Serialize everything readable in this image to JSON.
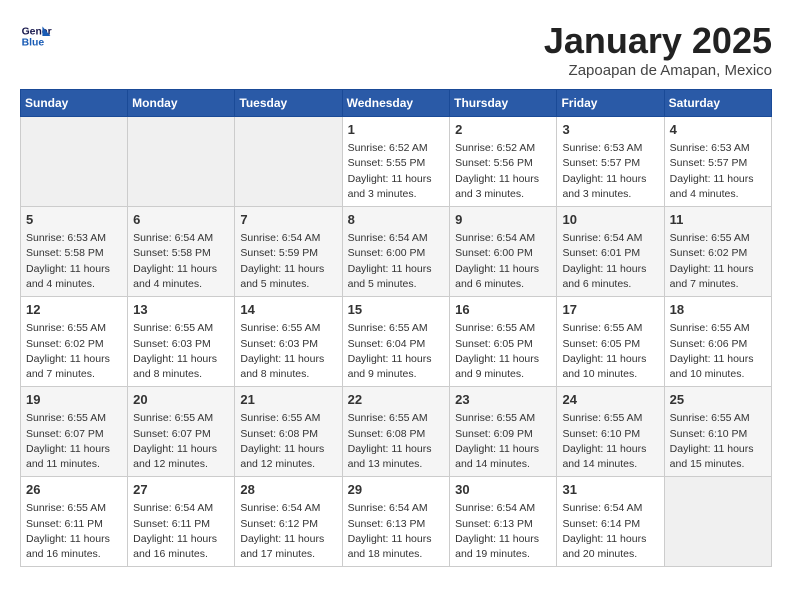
{
  "logo": {
    "line1": "General",
    "line2": "Blue"
  },
  "title": "January 2025",
  "location": "Zapoapan de Amapan, Mexico",
  "headers": [
    "Sunday",
    "Monday",
    "Tuesday",
    "Wednesday",
    "Thursday",
    "Friday",
    "Saturday"
  ],
  "weeks": [
    [
      {
        "day": "",
        "info": ""
      },
      {
        "day": "",
        "info": ""
      },
      {
        "day": "",
        "info": ""
      },
      {
        "day": "1",
        "info": "Sunrise: 6:52 AM\nSunset: 5:55 PM\nDaylight: 11 hours and 3 minutes."
      },
      {
        "day": "2",
        "info": "Sunrise: 6:52 AM\nSunset: 5:56 PM\nDaylight: 11 hours and 3 minutes."
      },
      {
        "day": "3",
        "info": "Sunrise: 6:53 AM\nSunset: 5:57 PM\nDaylight: 11 hours and 3 minutes."
      },
      {
        "day": "4",
        "info": "Sunrise: 6:53 AM\nSunset: 5:57 PM\nDaylight: 11 hours and 4 minutes."
      }
    ],
    [
      {
        "day": "5",
        "info": "Sunrise: 6:53 AM\nSunset: 5:58 PM\nDaylight: 11 hours and 4 minutes."
      },
      {
        "day": "6",
        "info": "Sunrise: 6:54 AM\nSunset: 5:58 PM\nDaylight: 11 hours and 4 minutes."
      },
      {
        "day": "7",
        "info": "Sunrise: 6:54 AM\nSunset: 5:59 PM\nDaylight: 11 hours and 5 minutes."
      },
      {
        "day": "8",
        "info": "Sunrise: 6:54 AM\nSunset: 6:00 PM\nDaylight: 11 hours and 5 minutes."
      },
      {
        "day": "9",
        "info": "Sunrise: 6:54 AM\nSunset: 6:00 PM\nDaylight: 11 hours and 6 minutes."
      },
      {
        "day": "10",
        "info": "Sunrise: 6:54 AM\nSunset: 6:01 PM\nDaylight: 11 hours and 6 minutes."
      },
      {
        "day": "11",
        "info": "Sunrise: 6:55 AM\nSunset: 6:02 PM\nDaylight: 11 hours and 7 minutes."
      }
    ],
    [
      {
        "day": "12",
        "info": "Sunrise: 6:55 AM\nSunset: 6:02 PM\nDaylight: 11 hours and 7 minutes."
      },
      {
        "day": "13",
        "info": "Sunrise: 6:55 AM\nSunset: 6:03 PM\nDaylight: 11 hours and 8 minutes."
      },
      {
        "day": "14",
        "info": "Sunrise: 6:55 AM\nSunset: 6:03 PM\nDaylight: 11 hours and 8 minutes."
      },
      {
        "day": "15",
        "info": "Sunrise: 6:55 AM\nSunset: 6:04 PM\nDaylight: 11 hours and 9 minutes."
      },
      {
        "day": "16",
        "info": "Sunrise: 6:55 AM\nSunset: 6:05 PM\nDaylight: 11 hours and 9 minutes."
      },
      {
        "day": "17",
        "info": "Sunrise: 6:55 AM\nSunset: 6:05 PM\nDaylight: 11 hours and 10 minutes."
      },
      {
        "day": "18",
        "info": "Sunrise: 6:55 AM\nSunset: 6:06 PM\nDaylight: 11 hours and 10 minutes."
      }
    ],
    [
      {
        "day": "19",
        "info": "Sunrise: 6:55 AM\nSunset: 6:07 PM\nDaylight: 11 hours and 11 minutes."
      },
      {
        "day": "20",
        "info": "Sunrise: 6:55 AM\nSunset: 6:07 PM\nDaylight: 11 hours and 12 minutes."
      },
      {
        "day": "21",
        "info": "Sunrise: 6:55 AM\nSunset: 6:08 PM\nDaylight: 11 hours and 12 minutes."
      },
      {
        "day": "22",
        "info": "Sunrise: 6:55 AM\nSunset: 6:08 PM\nDaylight: 11 hours and 13 minutes."
      },
      {
        "day": "23",
        "info": "Sunrise: 6:55 AM\nSunset: 6:09 PM\nDaylight: 11 hours and 14 minutes."
      },
      {
        "day": "24",
        "info": "Sunrise: 6:55 AM\nSunset: 6:10 PM\nDaylight: 11 hours and 14 minutes."
      },
      {
        "day": "25",
        "info": "Sunrise: 6:55 AM\nSunset: 6:10 PM\nDaylight: 11 hours and 15 minutes."
      }
    ],
    [
      {
        "day": "26",
        "info": "Sunrise: 6:55 AM\nSunset: 6:11 PM\nDaylight: 11 hours and 16 minutes."
      },
      {
        "day": "27",
        "info": "Sunrise: 6:54 AM\nSunset: 6:11 PM\nDaylight: 11 hours and 16 minutes."
      },
      {
        "day": "28",
        "info": "Sunrise: 6:54 AM\nSunset: 6:12 PM\nDaylight: 11 hours and 17 minutes."
      },
      {
        "day": "29",
        "info": "Sunrise: 6:54 AM\nSunset: 6:13 PM\nDaylight: 11 hours and 18 minutes."
      },
      {
        "day": "30",
        "info": "Sunrise: 6:54 AM\nSunset: 6:13 PM\nDaylight: 11 hours and 19 minutes."
      },
      {
        "day": "31",
        "info": "Sunrise: 6:54 AM\nSunset: 6:14 PM\nDaylight: 11 hours and 20 minutes."
      },
      {
        "day": "",
        "info": ""
      }
    ]
  ]
}
